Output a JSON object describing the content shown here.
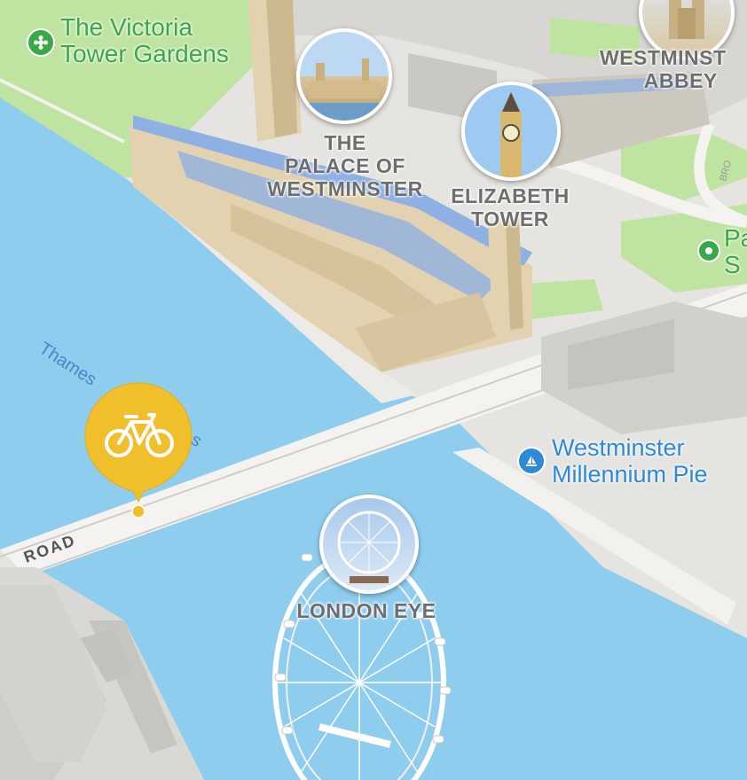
{
  "colors": {
    "water": "#8fcdef",
    "park": "#bfe3a0",
    "land": "#e6e4e0",
    "building": "#d7d6d2",
    "parliament_stone": "#e3d2b0",
    "parliament_roof": "#8eb0e2",
    "bike_pin": "#f0bf2c",
    "poi_green": "#3aa84a",
    "poi_blue": "#2d8ad6"
  },
  "labels": {
    "victoria_gardens": [
      "The Victoria",
      "Tower Gardens"
    ],
    "westminster_abbey": [
      "WESTMINST",
      "ABBEY"
    ],
    "palace": [
      "THE",
      "PALACE OF",
      "WESTMINSTER"
    ],
    "elizabeth_tower": [
      "ELIZABETH",
      "TOWER"
    ],
    "park_partial": [
      "Pa",
      "S"
    ],
    "thames": "Thames",
    "thames_tail": "s",
    "pier": [
      "Westminster",
      "Millennium Pie"
    ],
    "road": "ROAD",
    "london_eye": "LONDON EYE"
  },
  "icons": {
    "garden_poi": "flower-icon",
    "park_poi": "dot-icon",
    "pier_poi": "sailboat-icon",
    "bike_pin": "bicycle-icon",
    "street_tag": "BRO"
  }
}
